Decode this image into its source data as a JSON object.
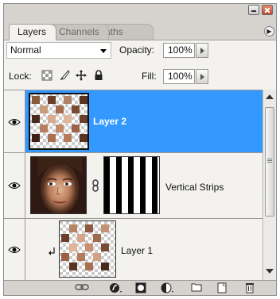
{
  "tabs": [
    {
      "label": "Layers",
      "active": true
    },
    {
      "label": "Channels",
      "active": false
    },
    {
      "label": "Paths",
      "active": false
    }
  ],
  "blend_mode": {
    "value": "Normal"
  },
  "opacity": {
    "label": "Opacity:",
    "value": "100%"
  },
  "lock": {
    "label": "Lock:"
  },
  "fill": {
    "label": "Fill:",
    "value": "100%"
  },
  "layers": [
    {
      "name": "Layer 2",
      "selected": true,
      "visible": true
    },
    {
      "name": "Vertical Strips",
      "selected": false,
      "visible": true,
      "has_mask": true
    },
    {
      "name": "Layer 1",
      "selected": false,
      "visible": true,
      "clipped": true
    }
  ],
  "colors": {
    "selection": "#3399ff",
    "panel_bg": "#d6d3ce",
    "row_bg": "#f3f2ef"
  },
  "icons": {
    "title": [
      "minimize-icon",
      "close-icon"
    ],
    "lock": [
      "lock-transparent-icon",
      "lock-paint-icon",
      "lock-move-icon",
      "lock-all-icon"
    ],
    "bottom": [
      "link-layers-icon",
      "layer-style-icon",
      "add-mask-icon",
      "adjustment-layer-icon",
      "new-group-icon",
      "new-layer-icon",
      "delete-layer-icon"
    ]
  }
}
